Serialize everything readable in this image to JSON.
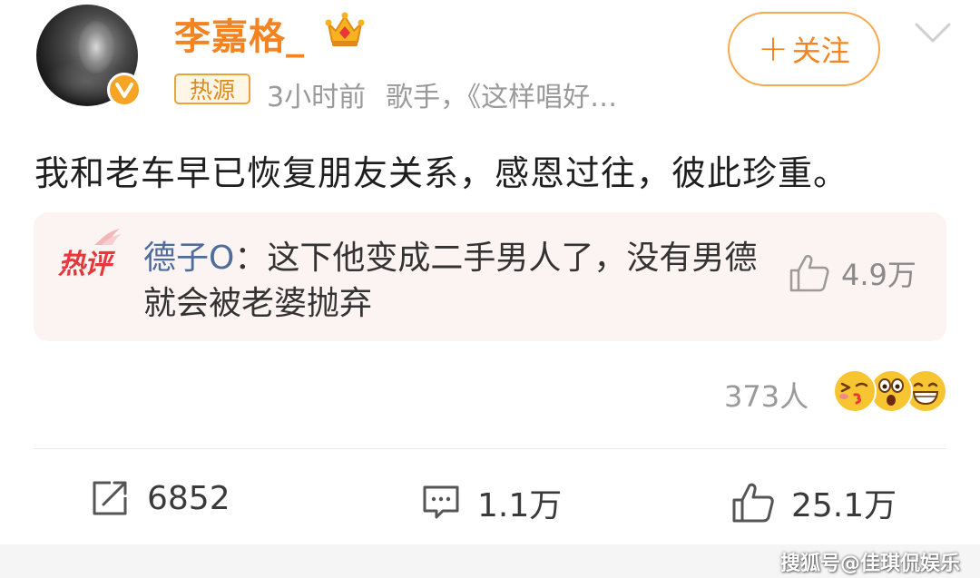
{
  "post": {
    "author": {
      "name": "李嘉格_",
      "avatar_icon": "user-avatar",
      "verified_icon": "verified-v-icon",
      "badge_icon": "crown-icon"
    },
    "follow_label": "关注",
    "follow_plus": "+",
    "hot_source_badge": "热源",
    "time": "3小时前",
    "source": "歌手，《这样唱好…",
    "text": "我和老车早已恢复朋友关系，感恩过往，彼此珍重。"
  },
  "hot_comment": {
    "tag": "热评",
    "author": "德子O",
    "separator": "：",
    "text": "这下他变成二手男人了，没有男德就会被老婆抛弃",
    "likes": "4.9万"
  },
  "reactions": {
    "count": "373人",
    "emojis": [
      "kiss-emoji",
      "surprised-emoji",
      "laugh-emoji"
    ]
  },
  "actions": {
    "repost": "6852",
    "comment": "1.1万",
    "like": "25.1万"
  },
  "watermark": "搜狐号@佳琪侃娱乐",
  "colors": {
    "accent": "#f5831f",
    "commenter": "#4e6d9c",
    "hot_tag": "#e8363a",
    "muted": "#9a9a9a"
  }
}
